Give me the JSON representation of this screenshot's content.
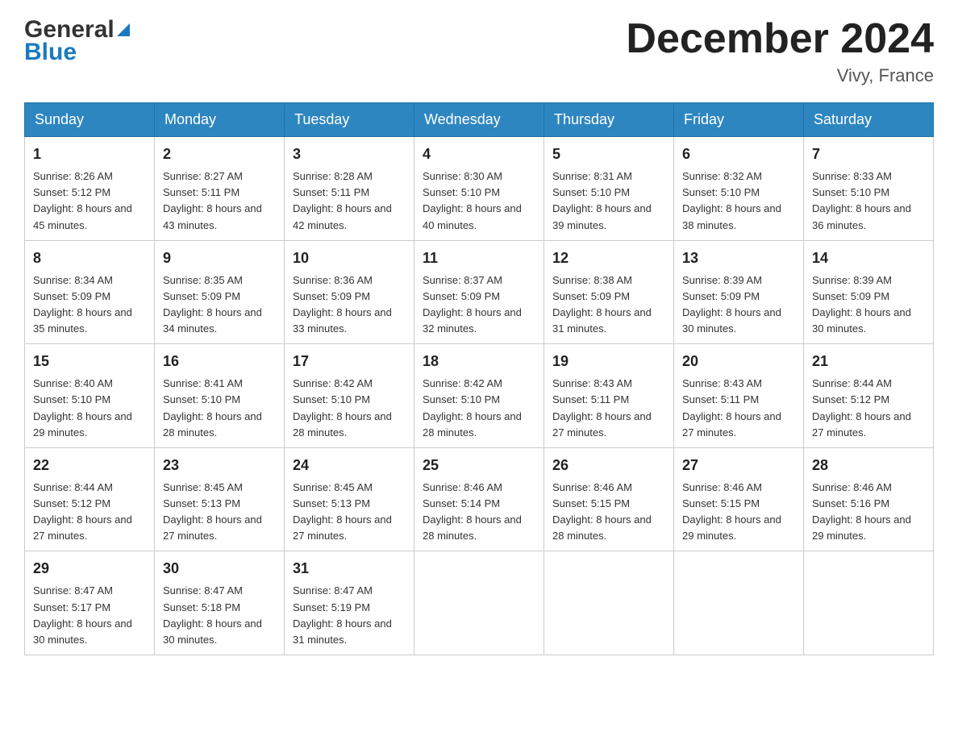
{
  "header": {
    "title": "December 2024",
    "location": "Vivy, France",
    "logo_general": "General",
    "logo_blue": "Blue"
  },
  "days_of_week": [
    "Sunday",
    "Monday",
    "Tuesday",
    "Wednesday",
    "Thursday",
    "Friday",
    "Saturday"
  ],
  "weeks": [
    [
      {
        "day": "1",
        "sunrise": "Sunrise: 8:26 AM",
        "sunset": "Sunset: 5:12 PM",
        "daylight": "Daylight: 8 hours and 45 minutes."
      },
      {
        "day": "2",
        "sunrise": "Sunrise: 8:27 AM",
        "sunset": "Sunset: 5:11 PM",
        "daylight": "Daylight: 8 hours and 43 minutes."
      },
      {
        "day": "3",
        "sunrise": "Sunrise: 8:28 AM",
        "sunset": "Sunset: 5:11 PM",
        "daylight": "Daylight: 8 hours and 42 minutes."
      },
      {
        "day": "4",
        "sunrise": "Sunrise: 8:30 AM",
        "sunset": "Sunset: 5:10 PM",
        "daylight": "Daylight: 8 hours and 40 minutes."
      },
      {
        "day": "5",
        "sunrise": "Sunrise: 8:31 AM",
        "sunset": "Sunset: 5:10 PM",
        "daylight": "Daylight: 8 hours and 39 minutes."
      },
      {
        "day": "6",
        "sunrise": "Sunrise: 8:32 AM",
        "sunset": "Sunset: 5:10 PM",
        "daylight": "Daylight: 8 hours and 38 minutes."
      },
      {
        "day": "7",
        "sunrise": "Sunrise: 8:33 AM",
        "sunset": "Sunset: 5:10 PM",
        "daylight": "Daylight: 8 hours and 36 minutes."
      }
    ],
    [
      {
        "day": "8",
        "sunrise": "Sunrise: 8:34 AM",
        "sunset": "Sunset: 5:09 PM",
        "daylight": "Daylight: 8 hours and 35 minutes."
      },
      {
        "day": "9",
        "sunrise": "Sunrise: 8:35 AM",
        "sunset": "Sunset: 5:09 PM",
        "daylight": "Daylight: 8 hours and 34 minutes."
      },
      {
        "day": "10",
        "sunrise": "Sunrise: 8:36 AM",
        "sunset": "Sunset: 5:09 PM",
        "daylight": "Daylight: 8 hours and 33 minutes."
      },
      {
        "day": "11",
        "sunrise": "Sunrise: 8:37 AM",
        "sunset": "Sunset: 5:09 PM",
        "daylight": "Daylight: 8 hours and 32 minutes."
      },
      {
        "day": "12",
        "sunrise": "Sunrise: 8:38 AM",
        "sunset": "Sunset: 5:09 PM",
        "daylight": "Daylight: 8 hours and 31 minutes."
      },
      {
        "day": "13",
        "sunrise": "Sunrise: 8:39 AM",
        "sunset": "Sunset: 5:09 PM",
        "daylight": "Daylight: 8 hours and 30 minutes."
      },
      {
        "day": "14",
        "sunrise": "Sunrise: 8:39 AM",
        "sunset": "Sunset: 5:09 PM",
        "daylight": "Daylight: 8 hours and 30 minutes."
      }
    ],
    [
      {
        "day": "15",
        "sunrise": "Sunrise: 8:40 AM",
        "sunset": "Sunset: 5:10 PM",
        "daylight": "Daylight: 8 hours and 29 minutes."
      },
      {
        "day": "16",
        "sunrise": "Sunrise: 8:41 AM",
        "sunset": "Sunset: 5:10 PM",
        "daylight": "Daylight: 8 hours and 28 minutes."
      },
      {
        "day": "17",
        "sunrise": "Sunrise: 8:42 AM",
        "sunset": "Sunset: 5:10 PM",
        "daylight": "Daylight: 8 hours and 28 minutes."
      },
      {
        "day": "18",
        "sunrise": "Sunrise: 8:42 AM",
        "sunset": "Sunset: 5:10 PM",
        "daylight": "Daylight: 8 hours and 28 minutes."
      },
      {
        "day": "19",
        "sunrise": "Sunrise: 8:43 AM",
        "sunset": "Sunset: 5:11 PM",
        "daylight": "Daylight: 8 hours and 27 minutes."
      },
      {
        "day": "20",
        "sunrise": "Sunrise: 8:43 AM",
        "sunset": "Sunset: 5:11 PM",
        "daylight": "Daylight: 8 hours and 27 minutes."
      },
      {
        "day": "21",
        "sunrise": "Sunrise: 8:44 AM",
        "sunset": "Sunset: 5:12 PM",
        "daylight": "Daylight: 8 hours and 27 minutes."
      }
    ],
    [
      {
        "day": "22",
        "sunrise": "Sunrise: 8:44 AM",
        "sunset": "Sunset: 5:12 PM",
        "daylight": "Daylight: 8 hours and 27 minutes."
      },
      {
        "day": "23",
        "sunrise": "Sunrise: 8:45 AM",
        "sunset": "Sunset: 5:13 PM",
        "daylight": "Daylight: 8 hours and 27 minutes."
      },
      {
        "day": "24",
        "sunrise": "Sunrise: 8:45 AM",
        "sunset": "Sunset: 5:13 PM",
        "daylight": "Daylight: 8 hours and 27 minutes."
      },
      {
        "day": "25",
        "sunrise": "Sunrise: 8:46 AM",
        "sunset": "Sunset: 5:14 PM",
        "daylight": "Daylight: 8 hours and 28 minutes."
      },
      {
        "day": "26",
        "sunrise": "Sunrise: 8:46 AM",
        "sunset": "Sunset: 5:15 PM",
        "daylight": "Daylight: 8 hours and 28 minutes."
      },
      {
        "day": "27",
        "sunrise": "Sunrise: 8:46 AM",
        "sunset": "Sunset: 5:15 PM",
        "daylight": "Daylight: 8 hours and 29 minutes."
      },
      {
        "day": "28",
        "sunrise": "Sunrise: 8:46 AM",
        "sunset": "Sunset: 5:16 PM",
        "daylight": "Daylight: 8 hours and 29 minutes."
      }
    ],
    [
      {
        "day": "29",
        "sunrise": "Sunrise: 8:47 AM",
        "sunset": "Sunset: 5:17 PM",
        "daylight": "Daylight: 8 hours and 30 minutes."
      },
      {
        "day": "30",
        "sunrise": "Sunrise: 8:47 AM",
        "sunset": "Sunset: 5:18 PM",
        "daylight": "Daylight: 8 hours and 30 minutes."
      },
      {
        "day": "31",
        "sunrise": "Sunrise: 8:47 AM",
        "sunset": "Sunset: 5:19 PM",
        "daylight": "Daylight: 8 hours and 31 minutes."
      },
      null,
      null,
      null,
      null
    ]
  ]
}
